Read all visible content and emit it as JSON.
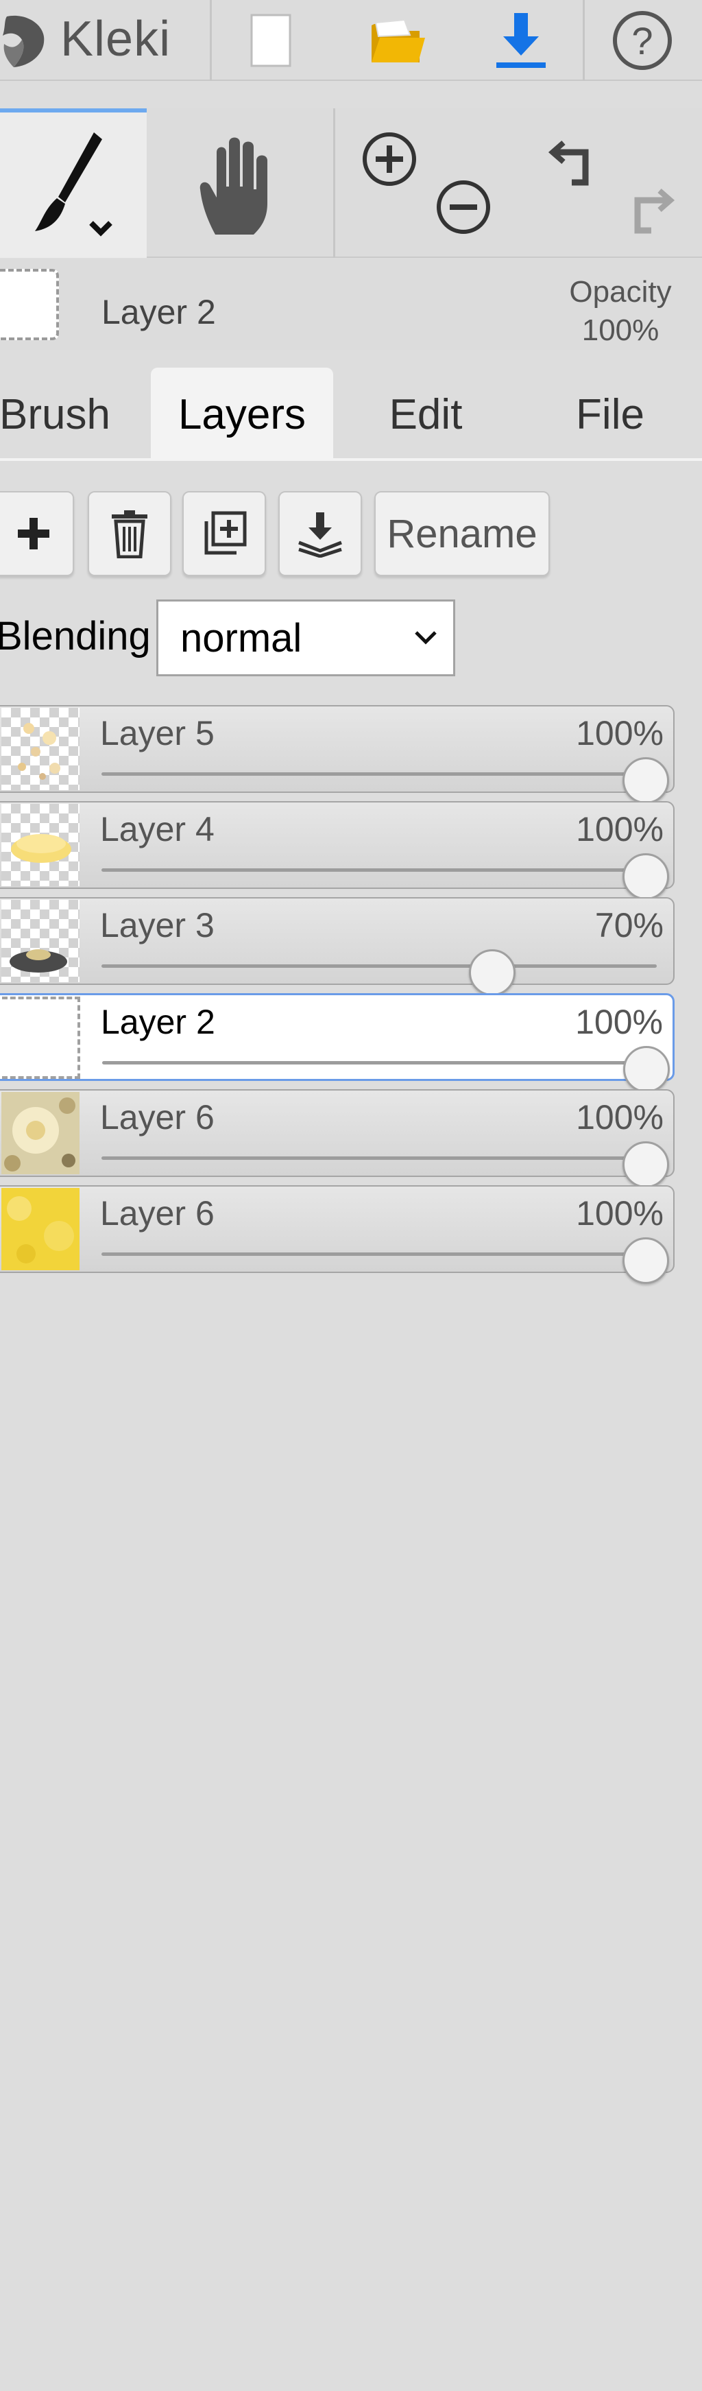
{
  "app": {
    "name": "Kleki"
  },
  "topbar": {
    "logo_text": "Kleki",
    "buttons": [
      {
        "icon": "new-file-icon",
        "label": "New"
      },
      {
        "icon": "open-folder-icon",
        "label": "Open"
      },
      {
        "icon": "download-icon",
        "label": "Save"
      },
      {
        "icon": "help-icon",
        "label": "Help"
      }
    ]
  },
  "toolbar": {
    "tools": [
      "brush-icon",
      "hand-icon",
      "zoom-in-icon",
      "zoom-out-icon",
      "undo-icon",
      "redo-icon"
    ]
  },
  "current_layer": {
    "name": "Layer 2",
    "opacity_label": "Opacity",
    "opacity_value": "100%"
  },
  "tabs": [
    {
      "label": "Brush",
      "active": false
    },
    {
      "label": "Layers",
      "active": true
    },
    {
      "label": "Edit",
      "active": false
    },
    {
      "label": "File",
      "active": false
    }
  ],
  "layer_actions": {
    "rename_label": "Rename"
  },
  "blending": {
    "label": "Blending",
    "value": "normal"
  },
  "layers": [
    {
      "name": "Layer 5",
      "opacity": "100%",
      "opacity_fraction": 1.0,
      "selected": false,
      "thumb": "confetti"
    },
    {
      "name": "Layer 4",
      "opacity": "100%",
      "opacity_fraction": 1.0,
      "selected": false,
      "thumb": "yellow-blob"
    },
    {
      "name": "Layer 3",
      "opacity": "70%",
      "opacity_fraction": 0.7,
      "selected": false,
      "thumb": "gray-blob"
    },
    {
      "name": "Layer 2",
      "opacity": "100%",
      "opacity_fraction": 1.0,
      "selected": true,
      "thumb": "empty"
    },
    {
      "name": "Layer 6",
      "opacity": "100%",
      "opacity_fraction": 1.0,
      "selected": false,
      "thumb": "cream-flower"
    },
    {
      "name": "Layer 6",
      "opacity": "100%",
      "opacity_fraction": 1.0,
      "selected": false,
      "thumb": "yellow-fill"
    }
  ],
  "colors": {
    "accent": "#6da9ef",
    "download_blue": "#1473e6",
    "folder_yellow": "#f2b705"
  }
}
